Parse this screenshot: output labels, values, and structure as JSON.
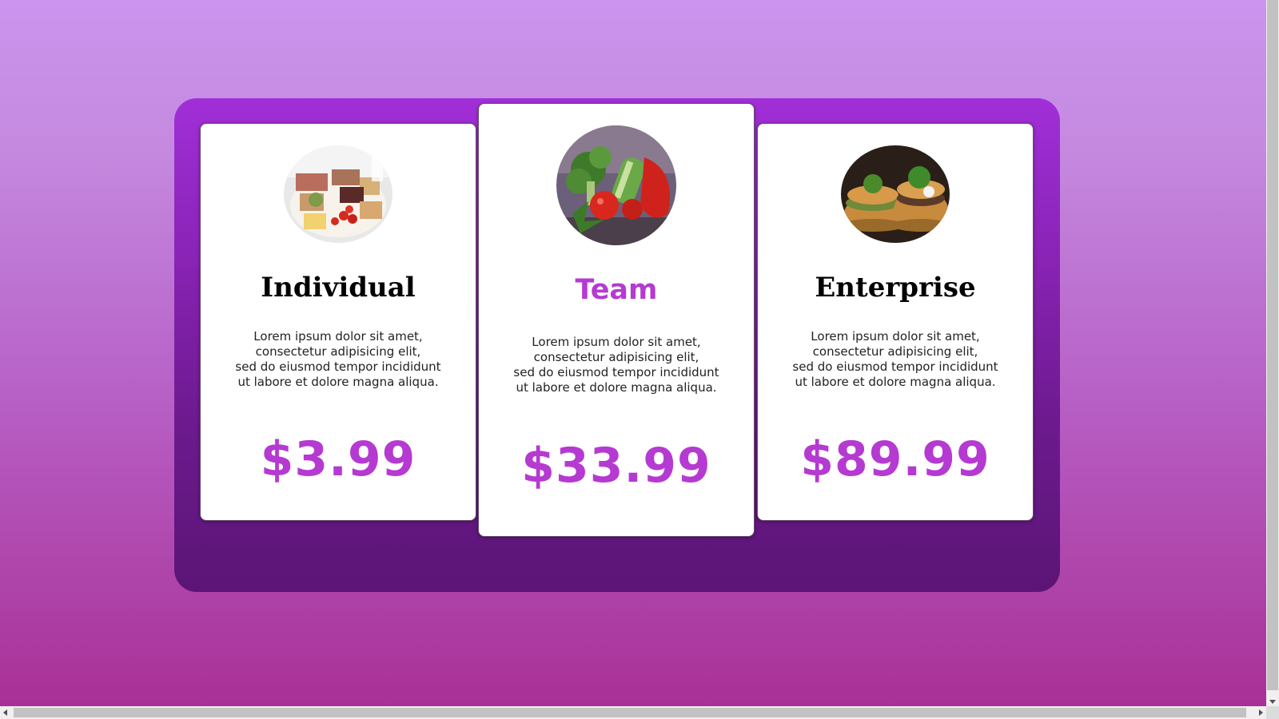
{
  "colors": {
    "accent": "#b53ad1",
    "panel": "#8b24b8",
    "card_bg": "#ffffff"
  },
  "plans": [
    {
      "name": "Individual",
      "image": "food-platter-image",
      "description": [
        "Lorem ipsum dolor sit amet,",
        "consectetur adipisicing elit,",
        "sed do eiusmod tempor incididunt",
        "ut labore et dolore magna aliqua."
      ],
      "price": "$3.99"
    },
    {
      "name": "Team",
      "image": "vegetables-image",
      "description": [
        "Lorem ipsum dolor sit amet,",
        "consectetur adipisicing elit,",
        "sed do eiusmod tempor incididunt",
        "ut labore et dolore magna aliqua."
      ],
      "price": "$33.99"
    },
    {
      "name": "Enterprise",
      "image": "burger-image",
      "description": [
        "Lorem ipsum dolor sit amet,",
        "consectetur adipisicing elit,",
        "sed do eiusmod tempor incididunt",
        "ut labore et dolore magna aliqua."
      ],
      "price": "$89.99"
    }
  ]
}
